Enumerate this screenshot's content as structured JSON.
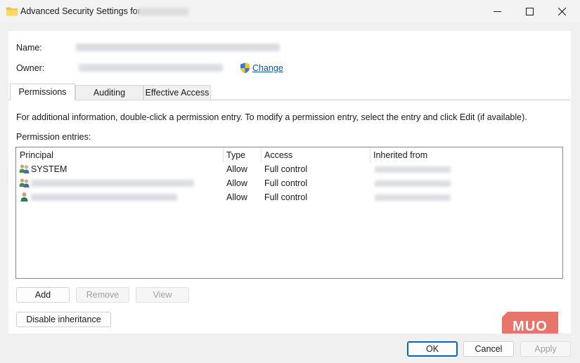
{
  "window": {
    "title": "Advanced Security Settings for",
    "controls": [
      "minimize",
      "maximize",
      "close"
    ]
  },
  "owner_section": {
    "name_label": "Name:",
    "owner_label": "Owner:",
    "change_link": "Change"
  },
  "tabs": [
    {
      "label": "Permissions",
      "active": true
    },
    {
      "label": "Auditing",
      "active": false
    },
    {
      "label": "Effective Access",
      "active": false
    }
  ],
  "panel": {
    "info_text": "For additional information, double-click a permission entry. To modify a permission entry, select the entry and click Edit (if available).",
    "entries_label": "Permission entries:"
  },
  "table": {
    "columns": [
      "Principal",
      "Type",
      "Access",
      "Inherited from"
    ],
    "rows": [
      {
        "principal": "SYSTEM",
        "icon": "group-users-icon",
        "type": "Allow",
        "access": "Full control"
      },
      {
        "principal": "",
        "icon": "group-users-icon",
        "type": "Allow",
        "access": "Full control"
      },
      {
        "principal": "",
        "icon": "user-icon",
        "type": "Allow",
        "access": "Full control"
      }
    ]
  },
  "buttons": {
    "add": "Add",
    "remove": "Remove",
    "view": "View",
    "disable_inheritance": "Disable inheritance",
    "ok": "OK",
    "cancel": "Cancel",
    "apply": "Apply"
  },
  "watermark": "MUO",
  "colors": {
    "link": "#0a57a5",
    "accent": "#0067c0",
    "watermark": "#e8756b"
  }
}
